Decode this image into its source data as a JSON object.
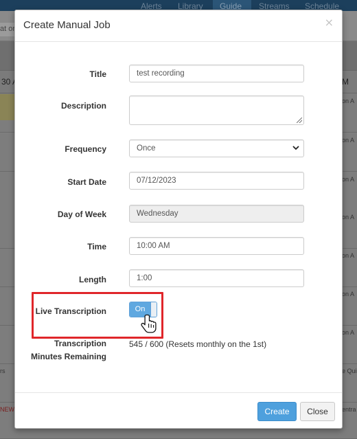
{
  "background": {
    "nav": [
      "Alerts",
      "Library",
      "Guide",
      "Streams",
      "Schedule"
    ],
    "active_nav": "Guide",
    "search_fragment": "at or",
    "header_time_left": "30 A",
    "header_time_right": "M",
    "row_fragment_right": "on A",
    "row_fragment_last_right": "e Qui",
    "row_fragment_last_left": "rs",
    "row_fragment_red_left": "NEW",
    "row_fragment_red_right": "entra"
  },
  "modal": {
    "title": "Create Manual Job",
    "close_glyph": "×",
    "fields": {
      "title": {
        "label": "Title",
        "value": "test recording"
      },
      "description": {
        "label": "Description",
        "value": ""
      },
      "frequency": {
        "label": "Frequency",
        "value": "Once"
      },
      "start_date": {
        "label": "Start Date",
        "value": "07/12/2023"
      },
      "day_of_week": {
        "label": "Day of Week",
        "value": "Wednesday"
      },
      "time": {
        "label": "Time",
        "value": "10:00 AM"
      },
      "length": {
        "label": "Length",
        "value": "1:00"
      },
      "live_transcription": {
        "label": "Live Transcription",
        "toggle_label": "On",
        "enabled": true
      },
      "transcription_minutes": {
        "label_line1": "Transcription",
        "label_line2": "Minutes Remaining",
        "value": "545 / 600 (Resets monthly on the 1st)"
      }
    },
    "buttons": {
      "create": "Create",
      "close": "Close"
    }
  },
  "colors": {
    "primary": "#4ea0dd",
    "toggle_on": "#5fa8e0",
    "highlight": "#e0262a"
  },
  "icons": {
    "cursor": "hand-pointer-icon",
    "select": "chevron-down-icon",
    "close": "close-icon"
  }
}
